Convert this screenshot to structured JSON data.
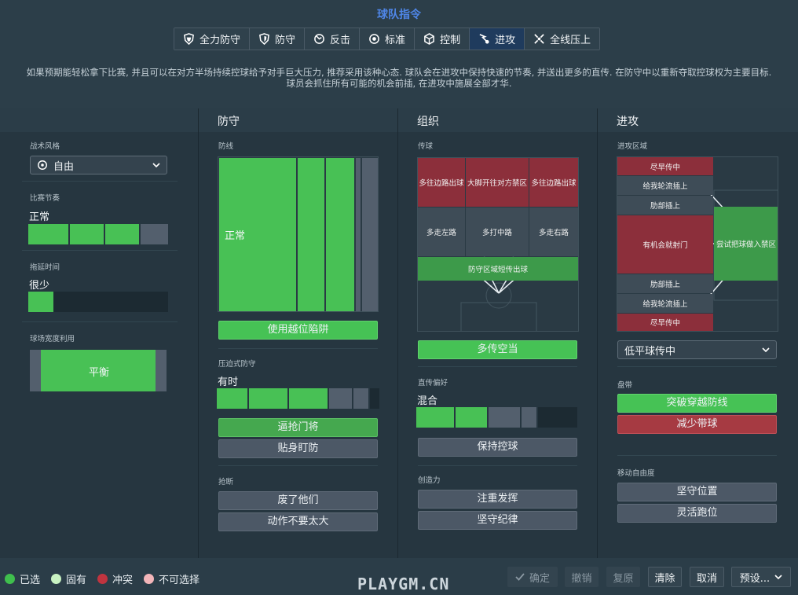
{
  "title": "球队指令",
  "mentality_tabs": [
    {
      "label": "全力防守",
      "icon": "shield-full-icon",
      "active": false
    },
    {
      "label": "防守",
      "icon": "shield-icon",
      "active": false
    },
    {
      "label": "反击",
      "icon": "counter-icon",
      "active": false
    },
    {
      "label": "标准",
      "icon": "balanced-icon",
      "active": false
    },
    {
      "label": "控制",
      "icon": "cube-icon",
      "active": false
    },
    {
      "label": "进攻",
      "icon": "attack-icon",
      "active": true
    },
    {
      "label": "全线压上",
      "icon": "overload-icon",
      "active": false
    }
  ],
  "description": "如果预期能轻松拿下比赛, 并且可以在对方半场持续控球给予对手巨大压力, 推荐采用该种心态. 球队会在进攻中保持快速的节奏, 并送出更多的直传. 在防守中以重新夺取控球权为主要目标. 球员会抓住所有可能的机会前插, 在进攻中施展全部才华.",
  "left": {
    "style_label": "战术风格",
    "style_value": "自由",
    "tempo_label": "比赛节奏",
    "tempo_value": "正常",
    "tempo_level": 0.75,
    "time_label": "拖延时间",
    "time_value": "很少",
    "time_level": 0.2,
    "width_label": "球场宽度利用",
    "width_value": "平衡"
  },
  "defense": {
    "header": "防守",
    "line_label": "防线",
    "line_value": "正常",
    "offside_btn": "使用越位陷阱",
    "press_label": "压迫式防守",
    "press_value": "有时",
    "press_level": 0.6,
    "press_btn1": "逼抢门将",
    "press_btn2": "贴身盯防",
    "tackle_label": "抢断",
    "tackle_btn1": "废了他们",
    "tackle_btn2": "动作不要太大"
  },
  "build": {
    "header": "组织",
    "pass_label": "传球",
    "cells": [
      "多往边路出球",
      "大脚开往对方禁区",
      "多往边路出球",
      "多走左路",
      "多打中路",
      "多走右路",
      "防守区域短传出球"
    ],
    "wide_btn": "多传空当",
    "direct_label": "直传偏好",
    "direct_value": "混合",
    "direct_level": 0.5,
    "keep_btn": "保持控球",
    "creative_label": "创造力",
    "creative_btn1": "注重发挥",
    "creative_btn2": "坚守纪律"
  },
  "attack": {
    "header": "进攻",
    "zone_label": "进攻区域",
    "cells": [
      "尽早传中",
      "给我轮流插上",
      "肋部插上",
      "有机会就射门",
      "尝试把球做入禁区",
      "肋部插上",
      "给我轮流插上",
      "尽早传中"
    ],
    "cross_dropdown": "低平球传中",
    "dribble_label": "盘带",
    "dribble_btn1": "突破穿越防线",
    "dribble_btn2": "减少带球",
    "move_label": "移动自由度",
    "move_btn1": "坚守位置",
    "move_btn2": "灵活跑位"
  },
  "legend": [
    {
      "label": "已选",
      "color": "#3fbf4d"
    },
    {
      "label": "固有",
      "color": "#c8f2c2"
    },
    {
      "label": "冲突",
      "color": "#c0343f"
    },
    {
      "label": "不可选择",
      "color": "#f2b5b9"
    }
  ],
  "footer": {
    "confirm": "确定",
    "undo": "撤销",
    "redo": "复原",
    "clear": "清除",
    "cancel": "取消",
    "preset": "预设..."
  },
  "watermark": "PLAYGM.CN"
}
